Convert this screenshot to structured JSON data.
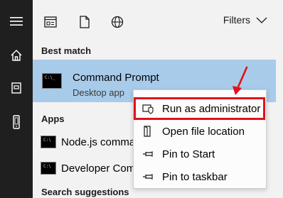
{
  "filter_bar": {
    "filters_label": "Filters",
    "icons": [
      "apps-filter-icon",
      "documents-filter-icon",
      "web-filter-icon",
      "chevron-down-icon"
    ]
  },
  "rail": {
    "icons": [
      "hamburger-menu-icon",
      "home-icon",
      "notebook-icon",
      "phone-icon"
    ]
  },
  "best_match": {
    "section_label": "Best match",
    "title": "Command Prompt",
    "subtitle": "Desktop app"
  },
  "apps": {
    "section_label": "Apps",
    "items": [
      {
        "label": "Node.js comma"
      },
      {
        "label": "Developer Com"
      }
    ]
  },
  "search_suggestions": {
    "section_label": "Search suggestions"
  },
  "context_menu": {
    "items": [
      {
        "label": "Run as administrator",
        "icon": "shield-run-icon"
      },
      {
        "label": "Open file location",
        "icon": "folder-location-icon"
      },
      {
        "label": "Pin to Start",
        "icon": "pin-icon"
      },
      {
        "label": "Pin to taskbar",
        "icon": "pin-icon"
      }
    ],
    "highlight_color": "#e2101a"
  },
  "colors": {
    "rail_bg": "#1f1f1f",
    "panel_bg": "#f2f2f2",
    "selection_bg": "#a8cbea",
    "annotation_red": "#e2101a"
  }
}
